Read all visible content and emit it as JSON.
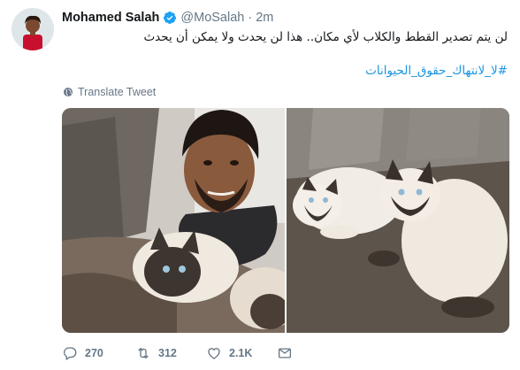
{
  "tweet": {
    "author_name": "Mohamed Salah",
    "handle": "@MoSalah",
    "dot": "·",
    "time": "2m",
    "text": "لن يتم تصدير القطط والكلاب لأي مكان.. هذا لن يحدث ولا يمكن أن يحدث",
    "hashtag": "#لا_لانتهاك_حقوق_الحيوانات",
    "translate_label": "Translate Tweet",
    "icons": {
      "avatar": "profile-photo",
      "verified": "verified-badge-icon",
      "translate": "globe-icon",
      "reply": "reply-icon",
      "retweet": "retweet-icon",
      "like": "heart-icon",
      "dm": "envelope-icon"
    },
    "photos": [
      "selfie-with-cat",
      "two-cats-on-rug"
    ]
  },
  "actions": {
    "reply_count": "270",
    "retweet_count": "312",
    "like_count": "2.1K"
  },
  "colors": {
    "link": "#1b95e0",
    "secondary_text": "#657786",
    "verified": "#1da1f2"
  }
}
